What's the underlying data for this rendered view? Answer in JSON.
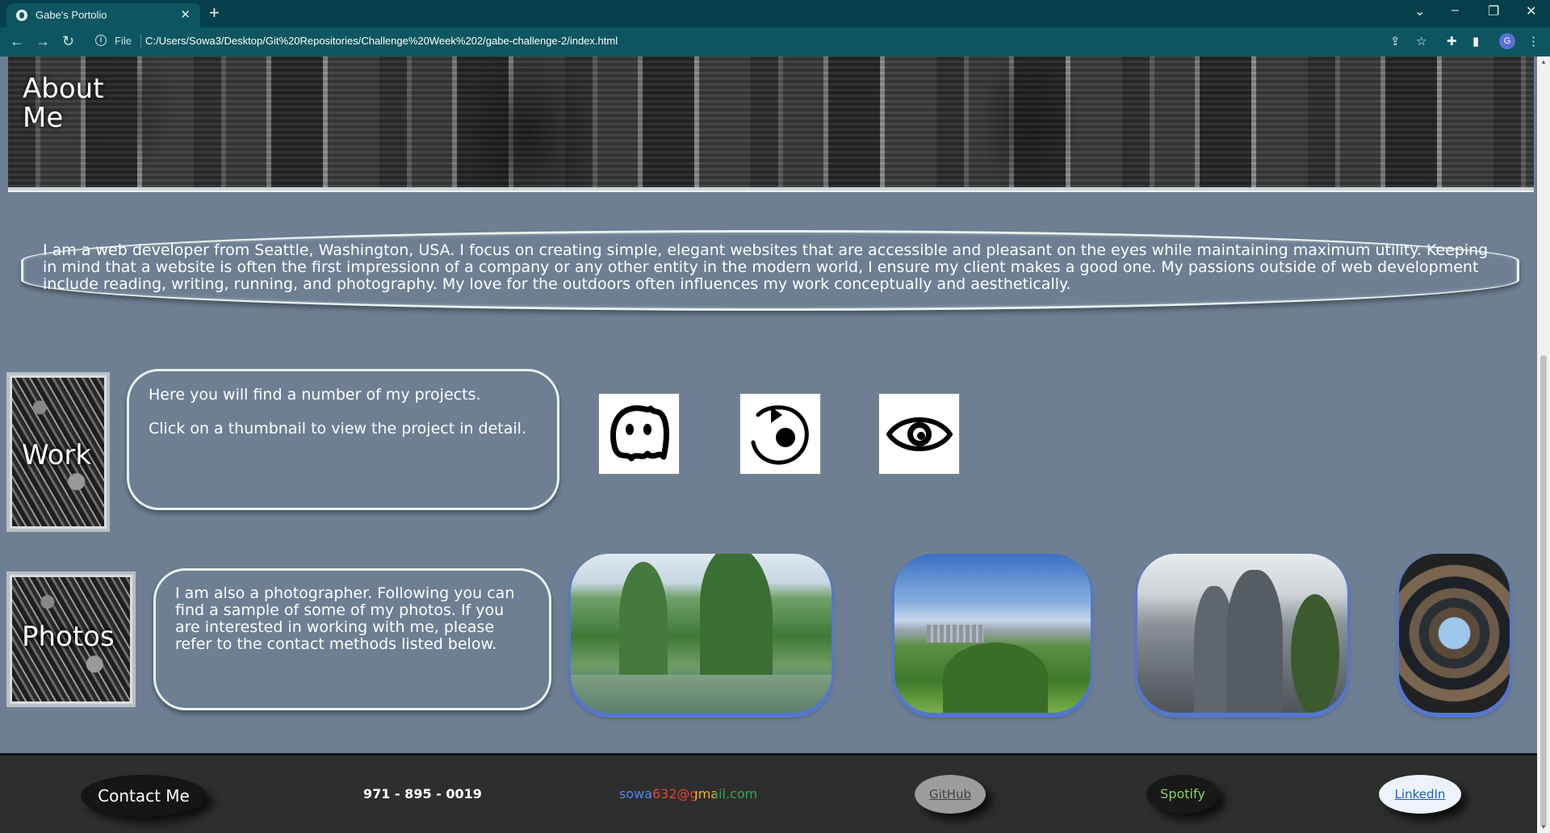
{
  "browser": {
    "tab_title": "Gabe's Portolio",
    "tab_close": "✕",
    "new_tab": "+",
    "url_scheme": "File",
    "url": "C:/Users/Sowa3/Desktop/Git%20Repositories/Challenge%20Week%202/gabe-challenge-2/index.html",
    "profile_initial": "G"
  },
  "banner": {
    "title": "About Me"
  },
  "about": {
    "text": "I am a web developer from Seattle, Washington, USA. I focus on creating simple, elegant websites that are accessible and pleasant on the eyes while maintaining maximum utility. Keeping in mind that a website is often the first impressionn of a company or any other entity in the modern world, I ensure my client makes a good one. My passions outside of web development include reading, writing, running, and photography. My love for the outdoors often influences my work conceptually and aesthetically."
  },
  "work": {
    "label": "Work",
    "line1": "Here you will find a number of my projects.",
    "line2": "Click on a thumbnail to view the project in detail.",
    "projects": [
      {
        "icon": "ghost-icon"
      },
      {
        "icon": "refresh-target-icon"
      },
      {
        "icon": "eye-icon"
      }
    ]
  },
  "photos": {
    "label": "Photos",
    "text": "I am also a photographer. Following you can find a sample of some of my photos. If you are interested in working with me, please refer to the contact methods listed below.",
    "images": [
      "karst-river-landscape",
      "seattle-skyline-park",
      "misty-rock-peaks",
      "spiral-atrium-sky"
    ]
  },
  "footer": {
    "contact": "Contact Me",
    "phone": "971 - 895 - 0019",
    "email": "sowa632@gmail.com",
    "github": "GitHub",
    "spotify": "Spotify",
    "linkedin": "LinkedIn"
  },
  "colors": {
    "page_bg": "#6e7f93",
    "footer_bg": "#2e2e2e",
    "chrome_bg": "#0d5560",
    "photo_border": "#5577cc"
  }
}
